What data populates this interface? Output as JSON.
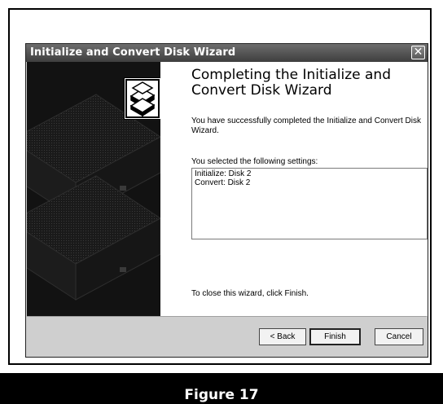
{
  "window": {
    "title": "Initialize and Convert Disk Wizard",
    "close_glyph": "✕"
  },
  "content": {
    "heading": "Completing the Initialize and Convert Disk Wizard",
    "intro": "You have successfully completed the Initialize and Convert Disk Wizard.",
    "settings_label": "You selected the following settings:",
    "settings": [
      "Initialize: Disk 2",
      "Convert: Disk 2"
    ],
    "close_note": "To close this wizard, click Finish."
  },
  "buttons": {
    "back": "< Back",
    "finish": "Finish",
    "cancel": "Cancel"
  },
  "caption": "Figure 17",
  "icons": {
    "wizard_logo": "disk-stack-icon",
    "side_art": "disk-stack-illustration"
  }
}
